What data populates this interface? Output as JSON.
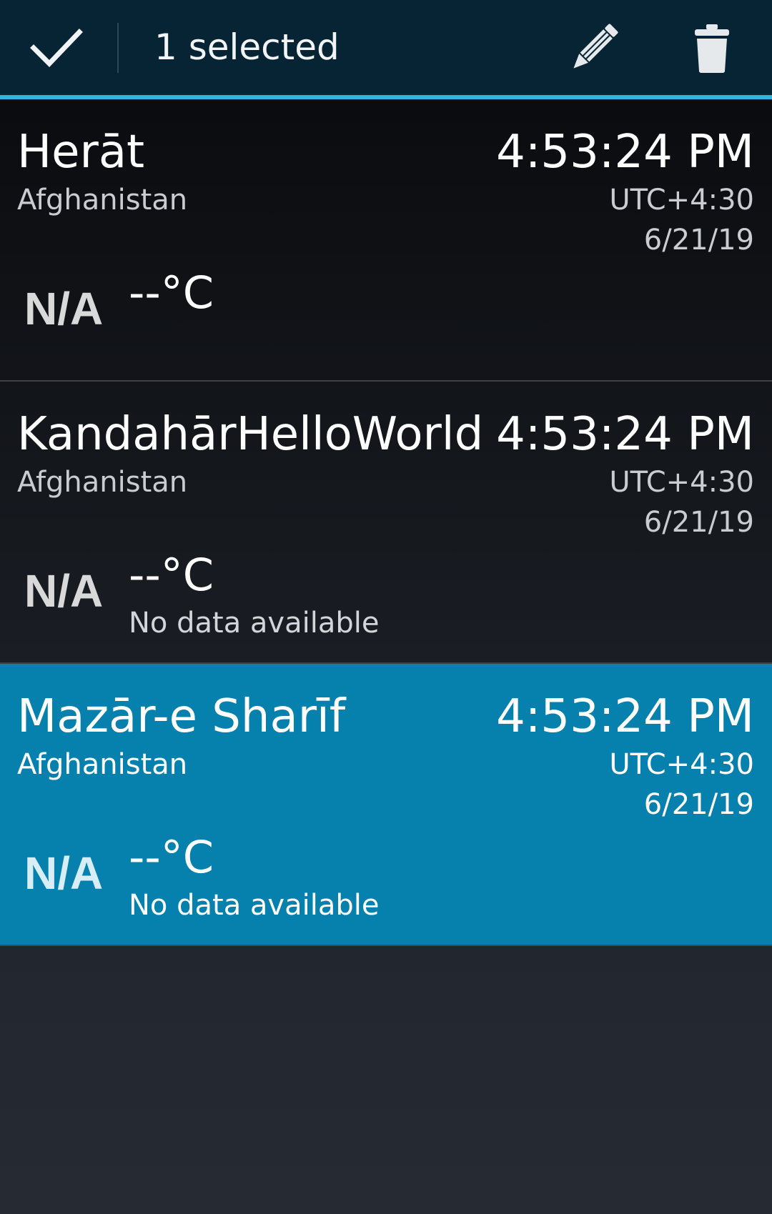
{
  "action_bar": {
    "title": "1 selected",
    "done_icon": "checkmark-icon",
    "edit_icon": "pencil-icon",
    "delete_icon": "trash-icon",
    "accent_color": "#2fb5e4"
  },
  "cities": [
    {
      "name": "Herāt",
      "country": "Afghanistan",
      "time": "4:53:24 PM",
      "utc_offset": "UTC+4:30",
      "date": "6/21/19",
      "weather_icon": "N/A",
      "temperature": "--°C",
      "status": "",
      "selected": false
    },
    {
      "name": "KandahārHelloWorld",
      "country": "Afghanistan",
      "time": "4:53:24 PM",
      "utc_offset": "UTC+4:30",
      "date": "6/21/19",
      "weather_icon": "N/A",
      "temperature": "--°C",
      "status": "No data available",
      "selected": false
    },
    {
      "name": "Mazār-e Sharīf",
      "country": "Afghanistan",
      "time": "4:53:24 PM",
      "utc_offset": "UTC+4:30",
      "date": "6/21/19",
      "weather_icon": "N/A",
      "temperature": "--°C",
      "status": "No data available",
      "selected": true
    }
  ],
  "colors": {
    "selected_row": "#0681ad",
    "action_bar_bg": "#062434"
  }
}
